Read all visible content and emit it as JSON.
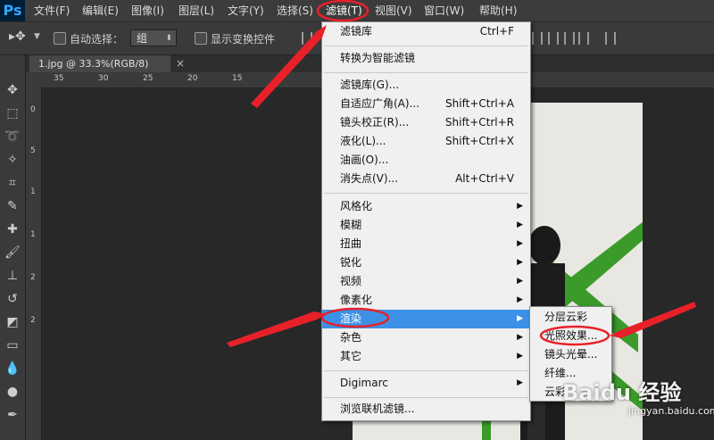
{
  "app": {
    "logo": "Ps"
  },
  "menubar": {
    "items": [
      {
        "label": "文件(F)"
      },
      {
        "label": "编辑(E)"
      },
      {
        "label": "图像(I)"
      },
      {
        "label": "图层(L)"
      },
      {
        "label": "文字(Y)"
      },
      {
        "label": "选择(S)"
      },
      {
        "label": "滤镜(T)"
      },
      {
        "label": "视图(V)"
      },
      {
        "label": "窗口(W)"
      },
      {
        "label": "帮助(H)"
      }
    ],
    "active": "滤镜(T)"
  },
  "options_bar": {
    "auto_select_label": "自动选择：",
    "auto_select_value": "组",
    "show_transform_label": "显示变换控件"
  },
  "document": {
    "tab_title": "1.jpg @ 33.3%(RGB/8)",
    "close_glyph": "×"
  },
  "rulers": {
    "h_ticks": [
      "35",
      "30",
      "25",
      "20",
      "15"
    ],
    "v_ticks": [
      "0",
      "5",
      "1",
      "1",
      "2",
      "2"
    ]
  },
  "filter_menu": {
    "items": [
      {
        "label": "滤镜库",
        "shortcut": "Ctrl+F"
      },
      {
        "label": "转换为智能滤镜"
      },
      {
        "label": "滤镜库(G)..."
      },
      {
        "label": "自适应广角(A)...",
        "shortcut": "Shift+Ctrl+A"
      },
      {
        "label": "镜头校正(R)...",
        "shortcut": "Shift+Ctrl+R"
      },
      {
        "label": "液化(L)...",
        "shortcut": "Shift+Ctrl+X"
      },
      {
        "label": "油画(O)..."
      },
      {
        "label": "消失点(V)...",
        "shortcut": "Alt+Ctrl+V"
      },
      {
        "label": "风格化",
        "submenu": true
      },
      {
        "label": "模糊",
        "submenu": true
      },
      {
        "label": "扭曲",
        "submenu": true
      },
      {
        "label": "锐化",
        "submenu": true
      },
      {
        "label": "视频",
        "submenu": true
      },
      {
        "label": "像素化",
        "submenu": true
      },
      {
        "label": "渲染",
        "submenu": true,
        "highlighted": true
      },
      {
        "label": "杂色",
        "submenu": true
      },
      {
        "label": "其它",
        "submenu": true
      },
      {
        "label": "Digimarc",
        "submenu": true
      },
      {
        "label": "浏览联机滤镜..."
      }
    ],
    "submenu_arrow": "▶"
  },
  "render_submenu": {
    "items": [
      {
        "label": "分层云彩"
      },
      {
        "label": "光照效果...",
        "circled": true
      },
      {
        "label": "镜头光晕..."
      },
      {
        "label": "纤维..."
      },
      {
        "label": "云彩"
      }
    ]
  },
  "watermark": {
    "brand": "Baidu 经验",
    "url": "jingyan.baidu.com"
  },
  "colors": {
    "menu_bg": "#f0f0f0",
    "highlight": "#3c91e6",
    "annotation_red": "#e8202a",
    "ps_blue": "#31a8ff",
    "photo_green": "#3a9a2a"
  }
}
